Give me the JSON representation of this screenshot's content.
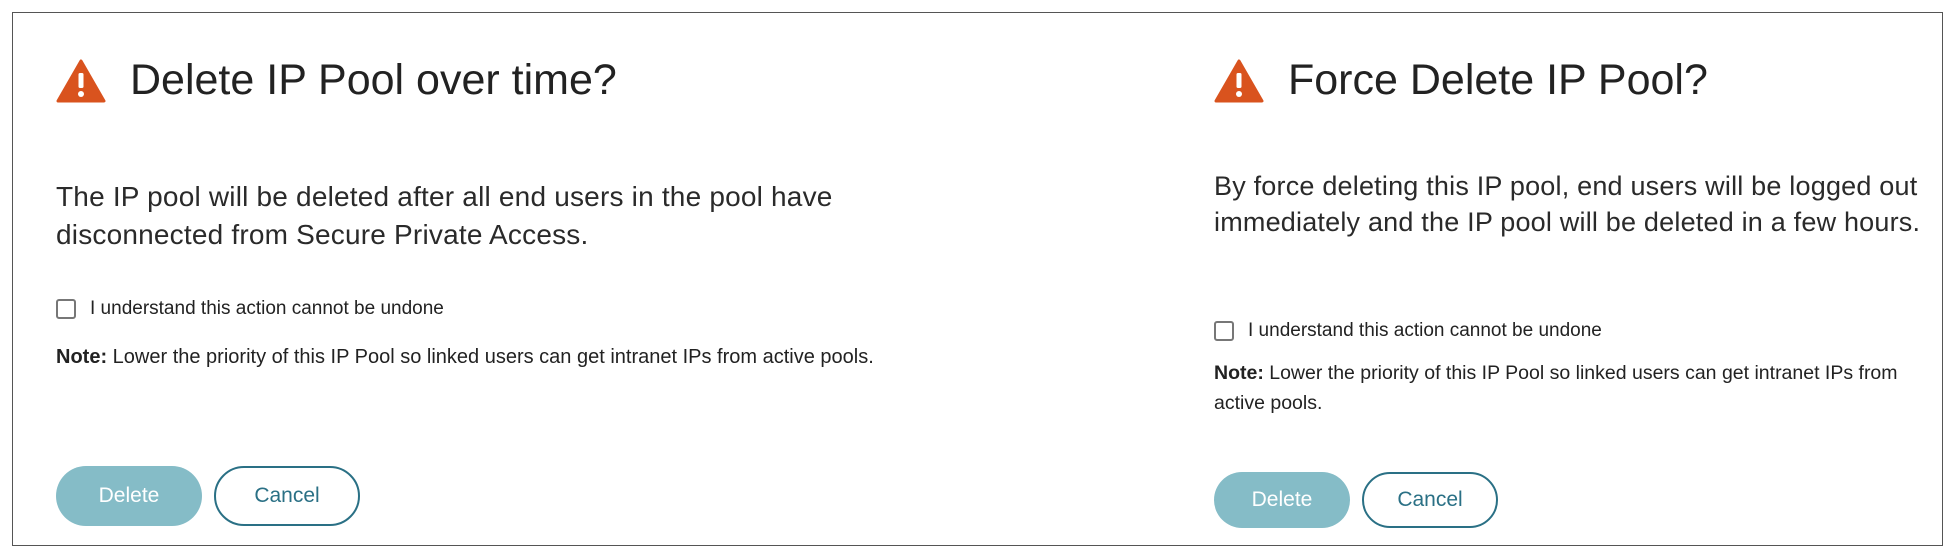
{
  "dialogs": [
    {
      "title": "Delete IP Pool over time?",
      "icon": "warning-icon",
      "body": "The IP pool will be deleted after all end users in the pool have disconnected from Secure Private Access.",
      "checkbox_label": "I understand this action cannot be undone",
      "checkbox_checked": false,
      "note_label": "Note:",
      "note_text": " Lower the priority of this IP Pool so linked users can get intranet IPs from active pools.",
      "delete_label": "Delete",
      "cancel_label": "Cancel"
    },
    {
      "title": "Force Delete IP Pool?",
      "icon": "warning-icon",
      "body": "By force deleting this IP pool, end users will be logged out immediately and the IP pool will be deleted in a few hours.",
      "checkbox_label": "I understand this action cannot be undone",
      "checkbox_checked": false,
      "note_label": "Note:",
      "note_text": " Lower the priority of this IP Pool so linked users can get intranet IPs from active pools.",
      "delete_label": "Delete",
      "cancel_label": "Cancel"
    }
  ],
  "colors": {
    "warning": "#d9531e",
    "primary_disabled": "#85bcc7",
    "secondary_accent": "#2a7085"
  }
}
